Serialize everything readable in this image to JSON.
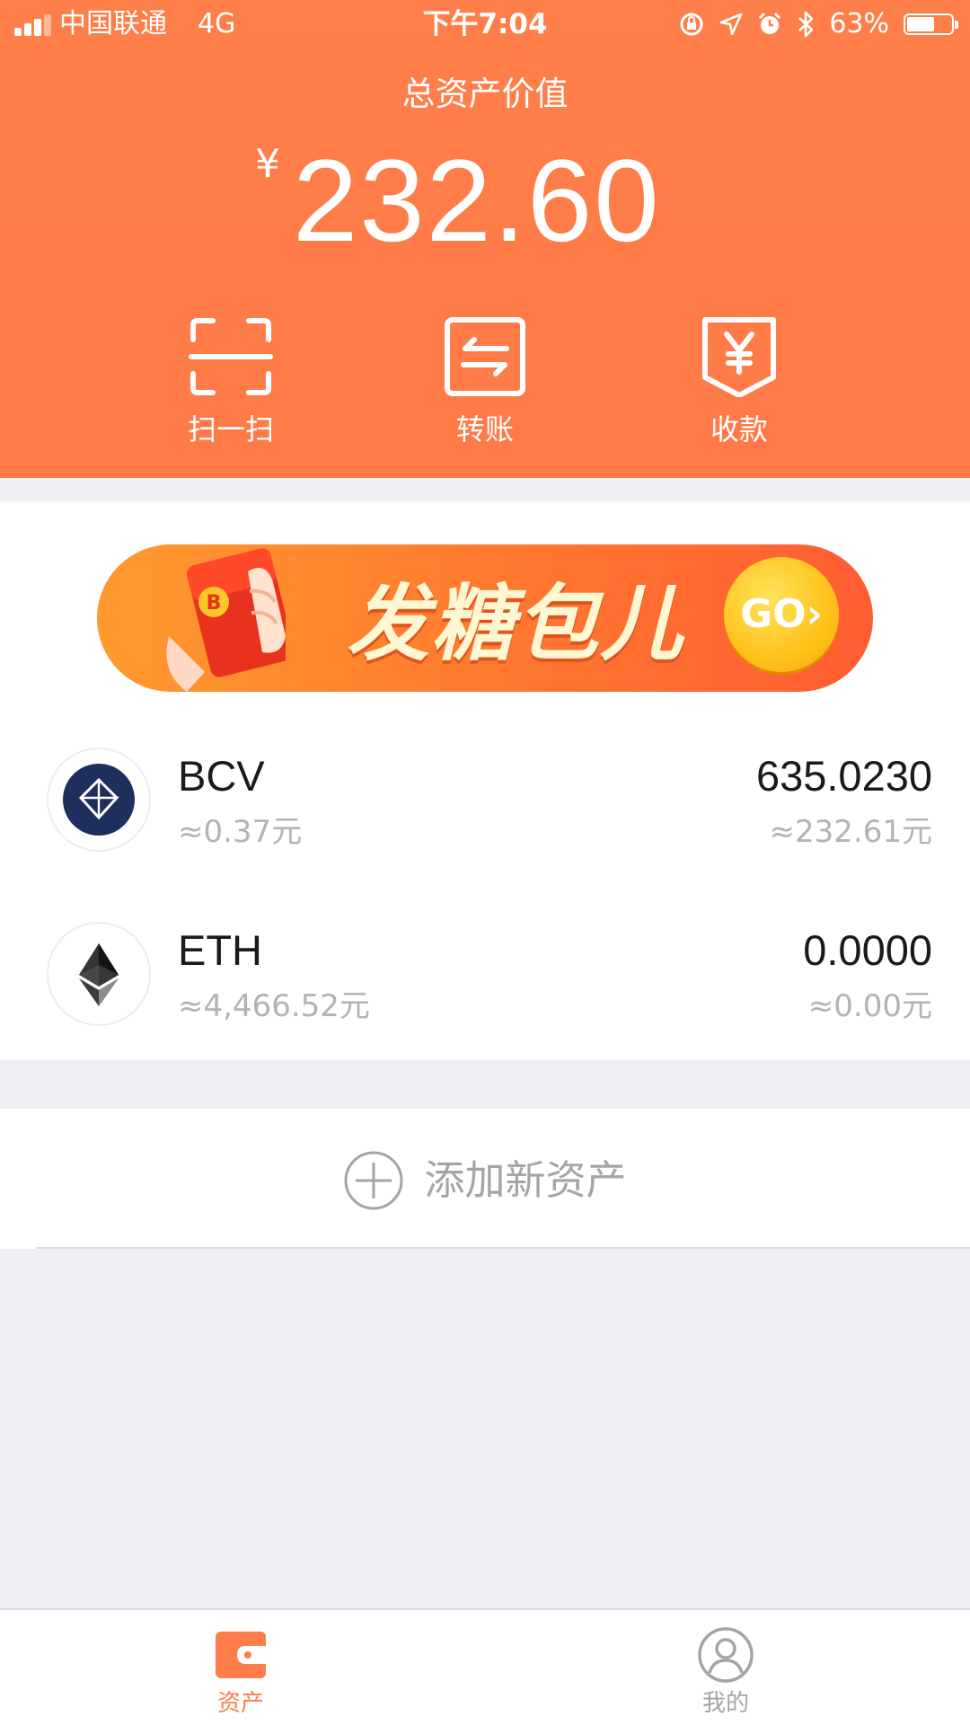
{
  "status_bar": {
    "carrier": "中国联通",
    "network": "4G",
    "time": "下午7:04",
    "battery_percent": "63%",
    "battery_level": 0.63
  },
  "header": {
    "total_label": "总资产价值",
    "currency_symbol": "¥",
    "total_value": "232.60",
    "actions": [
      {
        "label": "扫一扫",
        "icon": "scan-icon"
      },
      {
        "label": "转账",
        "icon": "transfer-icon"
      },
      {
        "label": "收款",
        "icon": "receive-icon"
      }
    ]
  },
  "banner": {
    "text": "发糖包儿",
    "go_label": "GO›",
    "envelope_letter": "B"
  },
  "assets": [
    {
      "symbol": "BCV",
      "price": "≈0.37元",
      "amount": "635.0230",
      "value": "≈232.61元",
      "icon": "bcv-icon"
    },
    {
      "symbol": "ETH",
      "price": "≈4,466.52元",
      "amount": "0.0000",
      "value": "≈0.00元",
      "icon": "eth-icon"
    }
  ],
  "add_asset": {
    "label": "添加新资产",
    "icon": "plus-circle-icon"
  },
  "tab_bar": {
    "tabs": [
      {
        "label": "资产",
        "icon": "wallet-icon",
        "active": true
      },
      {
        "label": "我的",
        "icon": "profile-icon",
        "active": false
      }
    ]
  },
  "colors": {
    "brand_orange": "#ff7d49",
    "inactive_gray": "#a5a5a5",
    "bcv_navy": "#1e2f5e"
  }
}
